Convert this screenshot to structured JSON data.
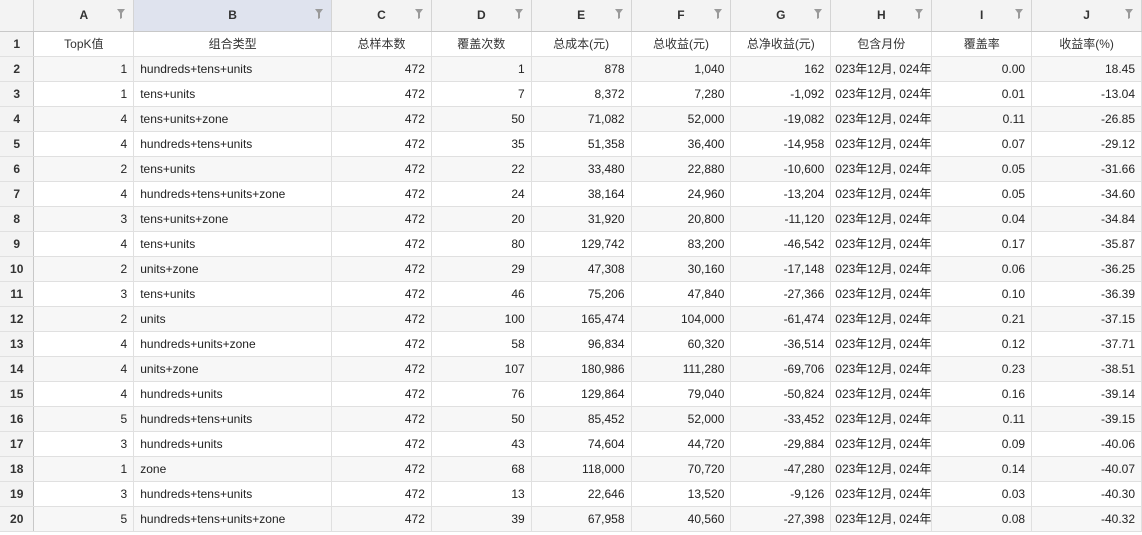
{
  "columns": [
    {
      "letter": "A"
    },
    {
      "letter": "B"
    },
    {
      "letter": "C"
    },
    {
      "letter": "D"
    },
    {
      "letter": "E"
    },
    {
      "letter": "F"
    },
    {
      "letter": "G"
    },
    {
      "letter": "H"
    },
    {
      "letter": "I"
    },
    {
      "letter": "J"
    }
  ],
  "filter_icon": "filter-icon",
  "header_row": {
    "row_number": "1",
    "cells": [
      "TopK值",
      "组合类型",
      "总样本数",
      "覆盖次数",
      "总成本(元)",
      "总收益(元)",
      "总净收益(元)",
      "包含月份",
      "覆盖率",
      "收益率(%)"
    ]
  },
  "rows": [
    {
      "row_number": "2",
      "cells": [
        "1",
        "hundreds+tens+units",
        "472",
        "1",
        "878",
        "1,040",
        "162",
        "023年12月, 024年",
        "0.00",
        "18.45"
      ]
    },
    {
      "row_number": "3",
      "cells": [
        "1",
        "tens+units",
        "472",
        "7",
        "8,372",
        "7,280",
        "-1,092",
        "023年12月, 024年",
        "0.01",
        "-13.04"
      ]
    },
    {
      "row_number": "4",
      "cells": [
        "4",
        "tens+units+zone",
        "472",
        "50",
        "71,082",
        "52,000",
        "-19,082",
        "023年12月, 024年",
        "0.11",
        "-26.85"
      ]
    },
    {
      "row_number": "5",
      "cells": [
        "4",
        "hundreds+tens+units",
        "472",
        "35",
        "51,358",
        "36,400",
        "-14,958",
        "023年12月, 024年",
        "0.07",
        "-29.12"
      ]
    },
    {
      "row_number": "6",
      "cells": [
        "2",
        "tens+units",
        "472",
        "22",
        "33,480",
        "22,880",
        "-10,600",
        "023年12月, 024年",
        "0.05",
        "-31.66"
      ]
    },
    {
      "row_number": "7",
      "cells": [
        "4",
        "hundreds+tens+units+zone",
        "472",
        "24",
        "38,164",
        "24,960",
        "-13,204",
        "023年12月, 024年",
        "0.05",
        "-34.60"
      ]
    },
    {
      "row_number": "8",
      "cells": [
        "3",
        "tens+units+zone",
        "472",
        "20",
        "31,920",
        "20,800",
        "-11,120",
        "023年12月, 024年",
        "0.04",
        "-34.84"
      ]
    },
    {
      "row_number": "9",
      "cells": [
        "4",
        "tens+units",
        "472",
        "80",
        "129,742",
        "83,200",
        "-46,542",
        "023年12月, 024年",
        "0.17",
        "-35.87"
      ]
    },
    {
      "row_number": "10",
      "cells": [
        "2",
        "units+zone",
        "472",
        "29",
        "47,308",
        "30,160",
        "-17,148",
        "023年12月, 024年",
        "0.06",
        "-36.25"
      ]
    },
    {
      "row_number": "11",
      "cells": [
        "3",
        "tens+units",
        "472",
        "46",
        "75,206",
        "47,840",
        "-27,366",
        "023年12月, 024年",
        "0.10",
        "-36.39"
      ]
    },
    {
      "row_number": "12",
      "cells": [
        "2",
        "units",
        "472",
        "100",
        "165,474",
        "104,000",
        "-61,474",
        "023年12月, 024年",
        "0.21",
        "-37.15"
      ]
    },
    {
      "row_number": "13",
      "cells": [
        "4",
        "hundreds+units+zone",
        "472",
        "58",
        "96,834",
        "60,320",
        "-36,514",
        "023年12月, 024年",
        "0.12",
        "-37.71"
      ]
    },
    {
      "row_number": "14",
      "cells": [
        "4",
        "units+zone",
        "472",
        "107",
        "180,986",
        "111,280",
        "-69,706",
        "023年12月, 024年",
        "0.23",
        "-38.51"
      ]
    },
    {
      "row_number": "15",
      "cells": [
        "4",
        "hundreds+units",
        "472",
        "76",
        "129,864",
        "79,040",
        "-50,824",
        "023年12月, 024年",
        "0.16",
        "-39.14"
      ]
    },
    {
      "row_number": "16",
      "cells": [
        "5",
        "hundreds+tens+units",
        "472",
        "50",
        "85,452",
        "52,000",
        "-33,452",
        "023年12月, 024年",
        "0.11",
        "-39.15"
      ]
    },
    {
      "row_number": "17",
      "cells": [
        "3",
        "hundreds+units",
        "472",
        "43",
        "74,604",
        "44,720",
        "-29,884",
        "023年12月, 024年",
        "0.09",
        "-40.06"
      ]
    },
    {
      "row_number": "18",
      "cells": [
        "1",
        "zone",
        "472",
        "68",
        "118,000",
        "70,720",
        "-47,280",
        "023年12月, 024年",
        "0.14",
        "-40.07"
      ]
    },
    {
      "row_number": "19",
      "cells": [
        "3",
        "hundreds+tens+units",
        "472",
        "13",
        "22,646",
        "13,520",
        "-9,126",
        "023年12月, 024年",
        "0.03",
        "-40.30"
      ]
    },
    {
      "row_number": "20",
      "cells": [
        "5",
        "hundreds+tens+units+zone",
        "472",
        "39",
        "67,958",
        "40,560",
        "-27,398",
        "023年12月, 024年",
        "0.08",
        "-40.32"
      ]
    }
  ]
}
